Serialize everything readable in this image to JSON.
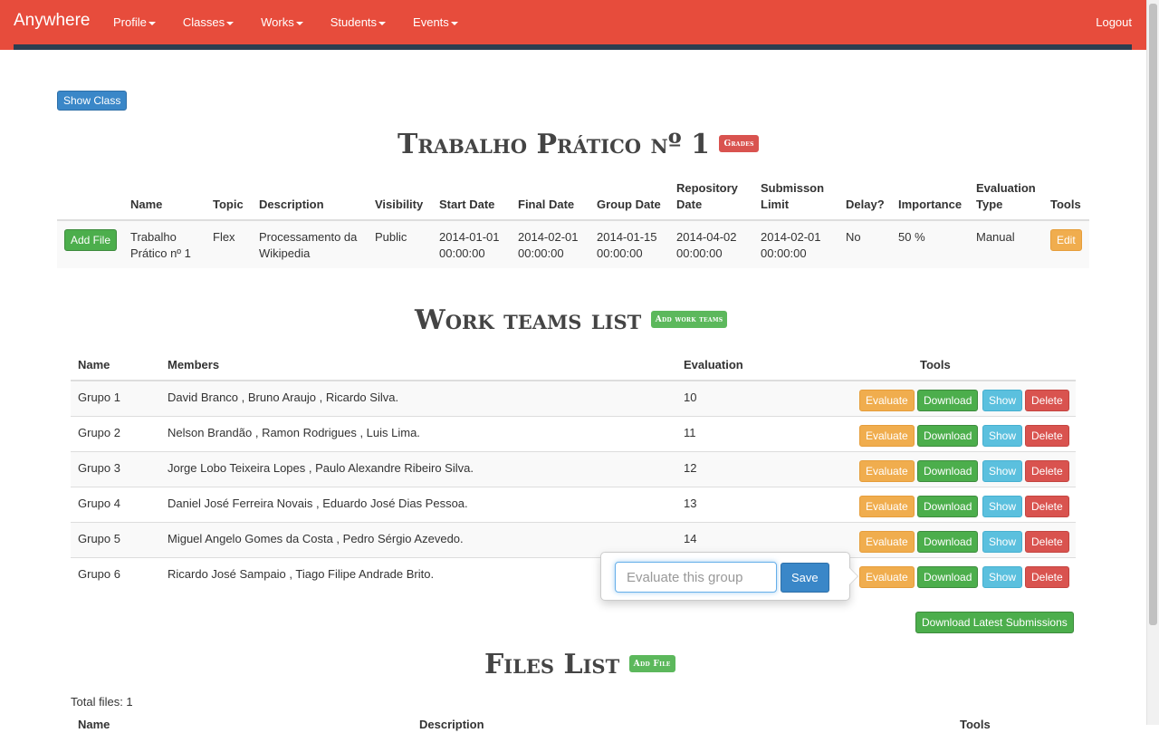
{
  "navbar": {
    "brand": "Anywhere",
    "items": [
      "Profile",
      "Classes",
      "Works",
      "Students",
      "Events"
    ],
    "logout": "Logout"
  },
  "show_class_button": "Show Class",
  "work": {
    "title": "Trabalho Prático nº 1",
    "grades_label": "Grades",
    "headers": {
      "name": "Name",
      "topic": "Topic",
      "description": "Description",
      "visibility": "Visibility",
      "start_date": "Start Date",
      "final_date": "Final Date",
      "group_date": "Group Date",
      "repository_date_1": "Repository",
      "repository_date_2": "Date",
      "submission_limit_1": "Submisson",
      "submission_limit_2": "Limit",
      "delay": "Delay?",
      "importance": "Importance",
      "evaluation_type_1": "Evaluation",
      "evaluation_type_2": "Type",
      "tools": "Tools"
    },
    "row": {
      "add_file": "Add File",
      "name_1": "Trabalho",
      "name_2": "Prático nº 1",
      "topic": "Flex",
      "description_1": "Processamento da",
      "description_2": "Wikipedia",
      "visibility": "Public",
      "start_date_1": "2014-01-01",
      "start_date_2": "00:00:00",
      "final_date_1": "2014-02-01",
      "final_date_2": "00:00:00",
      "group_date_1": "2014-01-15",
      "group_date_2": "00:00:00",
      "repository_date_1": "2014-04-02",
      "repository_date_2": "00:00:00",
      "submission_limit_1": "2014-02-01",
      "submission_limit_2": "00:00:00",
      "delay": "No",
      "importance": "50 %",
      "evaluation_type": "Manual",
      "edit": "Edit"
    }
  },
  "teams": {
    "title": "Work teams list",
    "add_label": "Add work teams",
    "headers": {
      "name": "Name",
      "members": "Members",
      "evaluation": "Evaluation",
      "tools": "Tools"
    },
    "tool_labels": {
      "evaluate": "Evaluate",
      "download": "Download",
      "show": "Show",
      "delete": "Delete"
    },
    "rows": [
      {
        "name": "Grupo 1",
        "members": "David Branco , Bruno Araujo , Ricardo Silva.",
        "evaluation": "10"
      },
      {
        "name": "Grupo 2",
        "members": "Nelson Brandão , Ramon Rodrigues , Luis Lima.",
        "evaluation": "11"
      },
      {
        "name": "Grupo 3",
        "members": "Jorge Lobo Teixeira Lopes , Paulo Alexandre Ribeiro Silva.",
        "evaluation": "12"
      },
      {
        "name": "Grupo 4",
        "members": "Daniel José Ferreira Novais , Eduardo José Dias Pessoa.",
        "evaluation": "13"
      },
      {
        "name": "Grupo 5",
        "members": "Miguel Angelo Gomes da Costa , Pedro Sérgio Azevedo.",
        "evaluation": "14"
      },
      {
        "name": "Grupo 6",
        "members": "Ricardo José Sampaio , Tiago Filipe Andrade Brito.",
        "evaluation": ""
      }
    ],
    "popover": {
      "placeholder": "Evaluate this group",
      "save": "Save"
    },
    "download_latest": "Download Latest Submissions"
  },
  "files": {
    "title": "Files List",
    "add_label": "Add File",
    "total": "Total files: 1",
    "headers": {
      "name": "Name",
      "description": "Description",
      "tools": "Tools"
    }
  }
}
